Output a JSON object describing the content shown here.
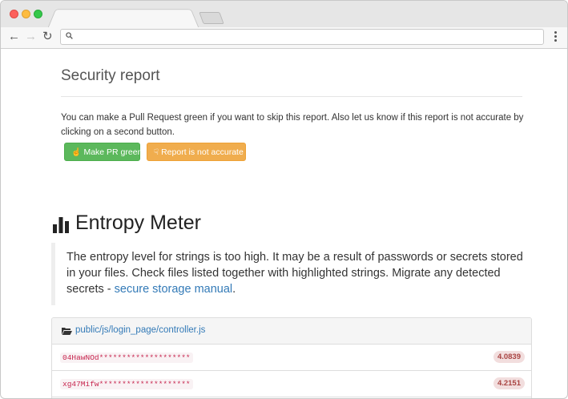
{
  "browser": {
    "url": ""
  },
  "security": {
    "title": "Security report",
    "description": "You can make a Pull Request green if you want to skip this report. Also let us know if this report is not accurate by clicking on a second button.",
    "btn_green": "Make PR green",
    "btn_orange": "Report is not accurate"
  },
  "entropy": {
    "title": "Entropy Meter",
    "text_before": "The entropy level for strings is too high. It may be a result of passwords or secrets stored in your files. Check files listed together with highlighted strings. Migrate any detected secrets - ",
    "link": "secure storage manual",
    "text_after": "."
  },
  "file_panel": {
    "path": "public/js/login_page/controller.js",
    "rows": [
      {
        "string": "04HawNOd********************",
        "score": "4.0839"
      },
      {
        "string": "xg47Mifw********************",
        "score": "4.2151"
      }
    ]
  },
  "icons": {
    "back": "arrow-left-icon",
    "forward": "arrow-right-icon",
    "reload": "reload-icon",
    "search": "search-icon",
    "menu": "menu-dots-icon",
    "thumbs_up": "thumbs-up-icon",
    "thumbs_down": "thumbs-down-icon",
    "chart": "bar-chart-icon",
    "folder": "folder-open-icon"
  },
  "colors": {
    "green_button": "#5cb85c",
    "orange_button": "#f0ad4e",
    "link": "#337ab7",
    "code_text": "#c7254e",
    "score_bg": "#f2dede"
  }
}
